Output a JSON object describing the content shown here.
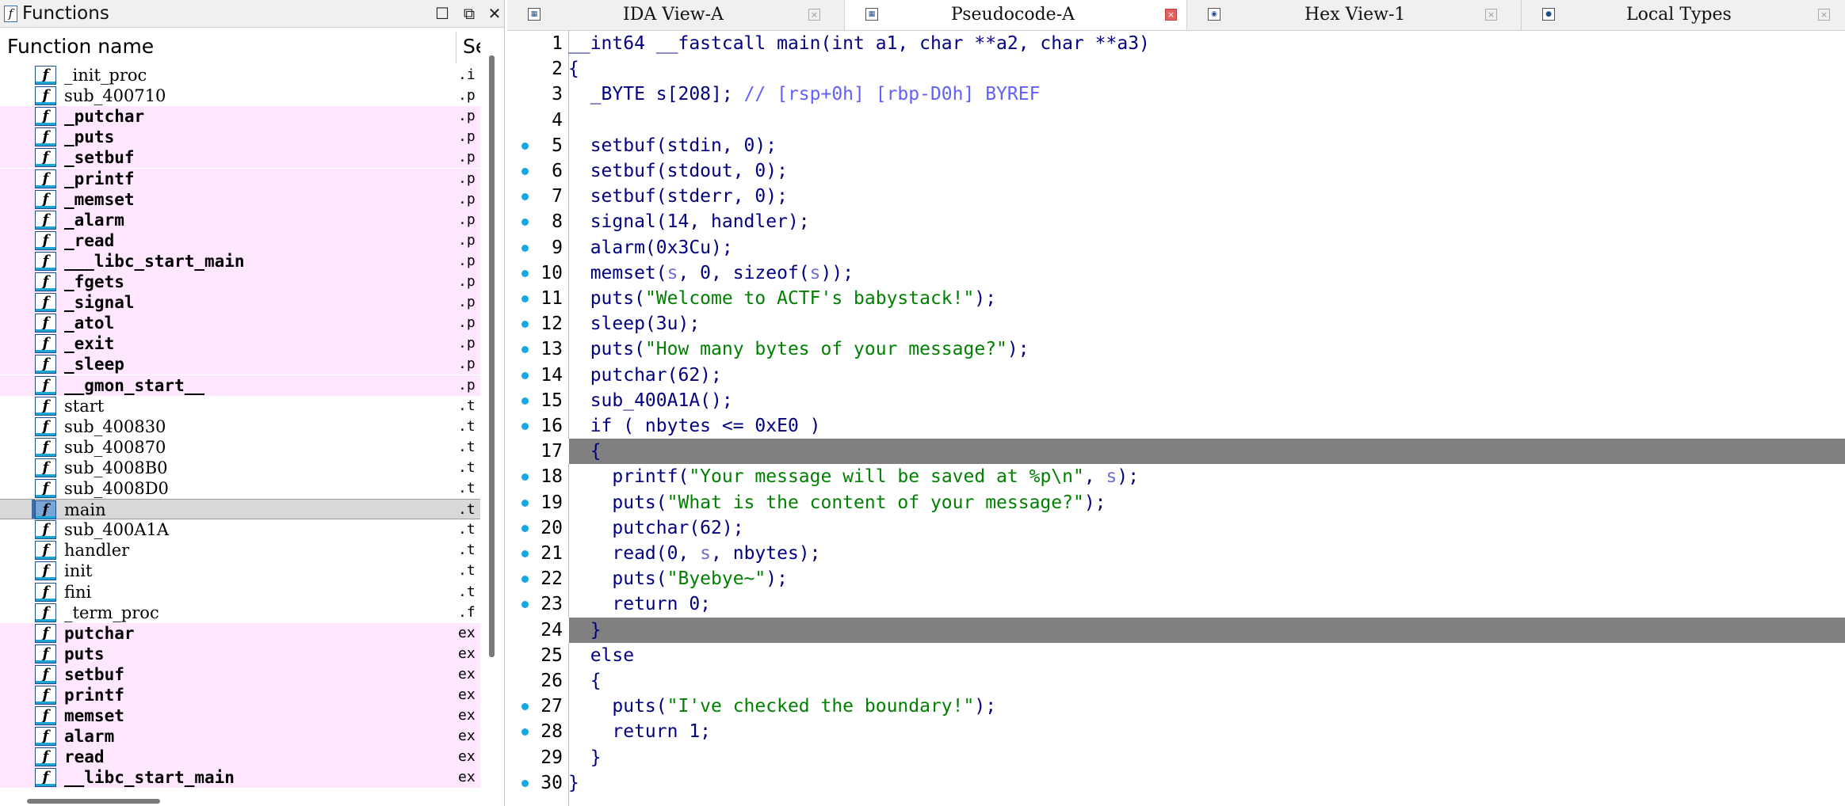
{
  "functions_pane": {
    "title": "Functions",
    "column_name": "Function name",
    "column_segment": "Se",
    "rows": [
      {
        "name": "_init_proc",
        "seg": ".i",
        "kind": "normal"
      },
      {
        "name": "sub_400710",
        "seg": ".p",
        "kind": "normal"
      },
      {
        "name": "_putchar",
        "seg": ".p",
        "kind": "lib"
      },
      {
        "name": "_puts",
        "seg": ".p",
        "kind": "lib"
      },
      {
        "name": "_setbuf",
        "seg": ".p",
        "kind": "lib"
      },
      {
        "name": "_printf",
        "seg": ".p",
        "kind": "lib"
      },
      {
        "name": "_memset",
        "seg": ".p",
        "kind": "lib"
      },
      {
        "name": "_alarm",
        "seg": ".p",
        "kind": "lib"
      },
      {
        "name": "_read",
        "seg": ".p",
        "kind": "lib"
      },
      {
        "name": "___libc_start_main",
        "seg": ".p",
        "kind": "lib"
      },
      {
        "name": "_fgets",
        "seg": ".p",
        "kind": "lib"
      },
      {
        "name": "_signal",
        "seg": ".p",
        "kind": "lib"
      },
      {
        "name": "_atol",
        "seg": ".p",
        "kind": "lib"
      },
      {
        "name": "_exit",
        "seg": ".p",
        "kind": "lib"
      },
      {
        "name": "_sleep",
        "seg": ".p",
        "kind": "lib"
      },
      {
        "name": "__gmon_start__",
        "seg": ".p",
        "kind": "lib"
      },
      {
        "name": "start",
        "seg": ".t",
        "kind": "normal"
      },
      {
        "name": "sub_400830",
        "seg": ".t",
        "kind": "normal"
      },
      {
        "name": "sub_400870",
        "seg": ".t",
        "kind": "normal"
      },
      {
        "name": "sub_4008B0",
        "seg": ".t",
        "kind": "normal"
      },
      {
        "name": "sub_4008D0",
        "seg": ".t",
        "kind": "normal"
      },
      {
        "name": "main",
        "seg": ".t",
        "kind": "selected"
      },
      {
        "name": "sub_400A1A",
        "seg": ".t",
        "kind": "normal"
      },
      {
        "name": "handler",
        "seg": ".t",
        "kind": "normal"
      },
      {
        "name": "init",
        "seg": ".t",
        "kind": "normal"
      },
      {
        "name": "fini",
        "seg": ".t",
        "kind": "normal"
      },
      {
        "name": "_term_proc",
        "seg": ".f",
        "kind": "normal"
      },
      {
        "name": "putchar",
        "seg": "ex",
        "kind": "imp"
      },
      {
        "name": "puts",
        "seg": "ex",
        "kind": "imp"
      },
      {
        "name": "setbuf",
        "seg": "ex",
        "kind": "imp"
      },
      {
        "name": "printf",
        "seg": "ex",
        "kind": "imp"
      },
      {
        "name": "memset",
        "seg": "ex",
        "kind": "imp"
      },
      {
        "name": "alarm",
        "seg": "ex",
        "kind": "imp"
      },
      {
        "name": "read",
        "seg": "ex",
        "kind": "imp"
      },
      {
        "name": "__libc_start_main",
        "seg": "ex",
        "kind": "imp"
      }
    ]
  },
  "tabs": [
    {
      "label": "IDA View-A",
      "active": false
    },
    {
      "label": "Pseudocode-A",
      "active": true
    },
    {
      "label": "Hex View-1",
      "active": false
    },
    {
      "label": "Local Types",
      "active": false
    }
  ],
  "colors": {
    "code_text": "#000080",
    "string": "#008000",
    "comment": "#6060ff",
    "variable": "#6f6fd0",
    "highlight_line": "#808080",
    "breakpoint_dot": "#18a7e0",
    "library_row": "#ffe8ff"
  },
  "code_lines": [
    {
      "n": "1",
      "dot": false,
      "hl": false,
      "tokens": [
        {
          "t": "__int64 __fastcall main(int a1, char **a2, char **a3)",
          "c": "code"
        }
      ]
    },
    {
      "n": "2",
      "dot": false,
      "hl": false,
      "tokens": [
        {
          "t": "{",
          "c": "code"
        }
      ]
    },
    {
      "n": "3",
      "dot": false,
      "hl": false,
      "tokens": [
        {
          "t": "  _BYTE s[208]; ",
          "c": "code"
        },
        {
          "t": "// [rsp+0h] [rbp-D0h] BYREF",
          "c": "comment"
        }
      ]
    },
    {
      "n": "4",
      "dot": false,
      "hl": false,
      "tokens": [
        {
          "t": "",
          "c": "code"
        }
      ]
    },
    {
      "n": "5",
      "dot": true,
      "hl": false,
      "tokens": [
        {
          "t": "  setbuf(stdin, 0);",
          "c": "code"
        }
      ]
    },
    {
      "n": "6",
      "dot": true,
      "hl": false,
      "tokens": [
        {
          "t": "  setbuf(stdout, 0);",
          "c": "code"
        }
      ]
    },
    {
      "n": "7",
      "dot": true,
      "hl": false,
      "tokens": [
        {
          "t": "  setbuf(stderr, 0);",
          "c": "code"
        }
      ]
    },
    {
      "n": "8",
      "dot": true,
      "hl": false,
      "tokens": [
        {
          "t": "  signal(14, handler);",
          "c": "code"
        }
      ]
    },
    {
      "n": "9",
      "dot": true,
      "hl": false,
      "tokens": [
        {
          "t": "  alarm(0x3Cu);",
          "c": "code"
        }
      ]
    },
    {
      "n": "10",
      "dot": true,
      "hl": false,
      "tokens": [
        {
          "t": "  memset(",
          "c": "code"
        },
        {
          "t": "s",
          "c": "var"
        },
        {
          "t": ", 0, sizeof(",
          "c": "code"
        },
        {
          "t": "s",
          "c": "var"
        },
        {
          "t": "));",
          "c": "code"
        }
      ]
    },
    {
      "n": "11",
      "dot": true,
      "hl": false,
      "tokens": [
        {
          "t": "  puts(",
          "c": "code"
        },
        {
          "t": "\"Welcome to ACTF's babystack!\"",
          "c": "string"
        },
        {
          "t": ");",
          "c": "code"
        }
      ]
    },
    {
      "n": "12",
      "dot": true,
      "hl": false,
      "tokens": [
        {
          "t": "  sleep(3u);",
          "c": "code"
        }
      ]
    },
    {
      "n": "13",
      "dot": true,
      "hl": false,
      "tokens": [
        {
          "t": "  puts(",
          "c": "code"
        },
        {
          "t": "\"How many bytes of your message?\"",
          "c": "string"
        },
        {
          "t": ");",
          "c": "code"
        }
      ]
    },
    {
      "n": "14",
      "dot": true,
      "hl": false,
      "tokens": [
        {
          "t": "  putchar(62);",
          "c": "code"
        }
      ]
    },
    {
      "n": "15",
      "dot": true,
      "hl": false,
      "tokens": [
        {
          "t": "  sub_400A1A();",
          "c": "code"
        }
      ]
    },
    {
      "n": "16",
      "dot": true,
      "hl": false,
      "tokens": [
        {
          "t": "  if ( nbytes <= 0xE0 )",
          "c": "code"
        }
      ]
    },
    {
      "n": "17",
      "dot": false,
      "hl": true,
      "tokens": [
        {
          "t": "  {",
          "c": "code"
        }
      ]
    },
    {
      "n": "18",
      "dot": true,
      "hl": false,
      "tokens": [
        {
          "t": "    printf(",
          "c": "code"
        },
        {
          "t": "\"Your message will be saved at %p\\n\"",
          "c": "string"
        },
        {
          "t": ", ",
          "c": "code"
        },
        {
          "t": "s",
          "c": "var"
        },
        {
          "t": ");",
          "c": "code"
        }
      ]
    },
    {
      "n": "19",
      "dot": true,
      "hl": false,
      "tokens": [
        {
          "t": "    puts(",
          "c": "code"
        },
        {
          "t": "\"What is the content of your message?\"",
          "c": "string"
        },
        {
          "t": ");",
          "c": "code"
        }
      ]
    },
    {
      "n": "20",
      "dot": true,
      "hl": false,
      "tokens": [
        {
          "t": "    putchar(62);",
          "c": "code"
        }
      ]
    },
    {
      "n": "21",
      "dot": true,
      "hl": false,
      "tokens": [
        {
          "t": "    read(0, ",
          "c": "code"
        },
        {
          "t": "s",
          "c": "var"
        },
        {
          "t": ", nbytes);",
          "c": "code"
        }
      ]
    },
    {
      "n": "22",
      "dot": true,
      "hl": false,
      "tokens": [
        {
          "t": "    puts(",
          "c": "code"
        },
        {
          "t": "\"Byebye~\"",
          "c": "string"
        },
        {
          "t": ");",
          "c": "code"
        }
      ]
    },
    {
      "n": "23",
      "dot": true,
      "hl": false,
      "tokens": [
        {
          "t": "    return 0;",
          "c": "code"
        }
      ]
    },
    {
      "n": "24",
      "dot": false,
      "hl": true,
      "tokens": [
        {
          "t": "  }",
          "c": "code"
        }
      ]
    },
    {
      "n": "25",
      "dot": false,
      "hl": false,
      "tokens": [
        {
          "t": "  else",
          "c": "code"
        }
      ]
    },
    {
      "n": "26",
      "dot": false,
      "hl": false,
      "tokens": [
        {
          "t": "  {",
          "c": "code"
        }
      ]
    },
    {
      "n": "27",
      "dot": true,
      "hl": false,
      "tokens": [
        {
          "t": "    puts(",
          "c": "code"
        },
        {
          "t": "\"I've checked the boundary!\"",
          "c": "string"
        },
        {
          "t": ");",
          "c": "code"
        }
      ]
    },
    {
      "n": "28",
      "dot": true,
      "hl": false,
      "tokens": [
        {
          "t": "    return 1;",
          "c": "code"
        }
      ]
    },
    {
      "n": "29",
      "dot": false,
      "hl": false,
      "tokens": [
        {
          "t": "  }",
          "c": "code"
        }
      ]
    },
    {
      "n": "30",
      "dot": true,
      "hl": false,
      "tokens": [
        {
          "t": "}",
          "c": "code"
        }
      ]
    }
  ]
}
